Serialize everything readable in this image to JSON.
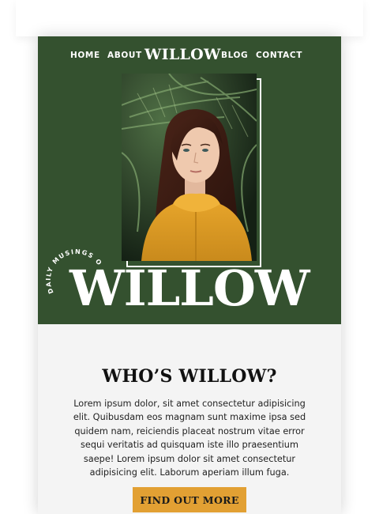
{
  "nav": {
    "items": [
      "HOME",
      "ABOUT",
      "BLOG",
      "CONTACT"
    ],
    "logo": "WILLOW"
  },
  "hero": {
    "circle_text": "DAILY MUSINGS OF",
    "title": "WILLOW",
    "background_color": "#34512f"
  },
  "about": {
    "heading": "WHO’S WILLOW?",
    "body": "Lorem ipsum dolor, sit amet consectetur adipisicing elit. Quibusdam eos magnam sunt maxime ipsa sed quidem nam, reiciendis placeat nostrum vitae error sequi veritatis ad quisquam iste illo praesentium saepe! Lorem ipsum dolor sit amet consectetur adipisicing elit. Laborum aperiam illum fuga.",
    "cta_label": "FIND OUT MORE",
    "cta_color": "#e2a033"
  }
}
